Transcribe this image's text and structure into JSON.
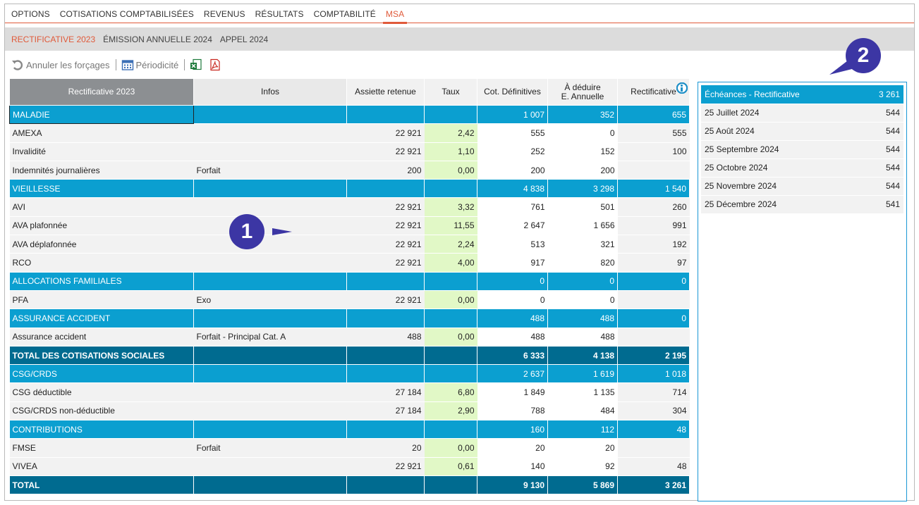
{
  "topnav": {
    "items": [
      "OPTIONS",
      "COTISATIONS COMPTABILISÉES",
      "REVENUS",
      "RÉSULTATS",
      "COMPTABILITÉ",
      "MSA"
    ],
    "active_index": 5
  },
  "subnav": {
    "items": [
      "RECTIFICATIVE 2023",
      "ÉMISSION ANNUELLE 2024",
      "APPEL 2024"
    ],
    "active_index": 0
  },
  "toolbar": {
    "cancel_label": "Annuler les forçages",
    "periodicity_label": "Périodicité"
  },
  "table": {
    "headers": {
      "first": "Rectificative 2023",
      "infos": "Infos",
      "assiette": "Assiette retenue",
      "taux": "Taux",
      "cot": "Cot. Définitives",
      "deduire_line1": "À déduire",
      "deduire_line2": "E. Annuelle",
      "rect": "Rectificative"
    },
    "rows": [
      {
        "type": "section",
        "label": "MALADIE",
        "infos": "",
        "assiette": "",
        "taux": "",
        "cot": "1 007",
        "ded": "352",
        "rect": "655"
      },
      {
        "type": "item",
        "label": "AMEXA",
        "info": true,
        "infos": "",
        "assiette": "22 921",
        "taux": "2,42",
        "cot": "555",
        "ded": "0",
        "rect": "555"
      },
      {
        "type": "item",
        "label": "Invalidité",
        "info": true,
        "infos": "",
        "assiette": "22 921",
        "taux": "1,10",
        "cot": "252",
        "ded": "152",
        "rect": "100"
      },
      {
        "type": "item",
        "label": "Indemnités journalières",
        "info": false,
        "infos": "Forfait",
        "assiette": "200",
        "taux": "0,00",
        "cot": "200",
        "ded": "200",
        "rect": ""
      },
      {
        "type": "section",
        "label": "VIEILLESSE",
        "infos": "",
        "assiette": "",
        "taux": "",
        "cot": "4 838",
        "ded": "3 298",
        "rect": "1 540"
      },
      {
        "type": "item",
        "label": "AVI",
        "info": true,
        "infos": "",
        "assiette": "22 921",
        "taux": "3,32",
        "cot": "761",
        "ded": "501",
        "rect": "260"
      },
      {
        "type": "item",
        "label": "AVA plafonnée",
        "info": true,
        "infos": "",
        "assiette": "22 921",
        "taux": "11,55",
        "cot": "2 647",
        "ded": "1 656",
        "rect": "991"
      },
      {
        "type": "item",
        "label": "AVA déplafonnée",
        "info": true,
        "infos": "",
        "assiette": "22 921",
        "taux": "2,24",
        "cot": "513",
        "ded": "321",
        "rect": "192"
      },
      {
        "type": "item",
        "label": "RCO",
        "info": true,
        "infos": "",
        "assiette": "22 921",
        "taux": "4,00",
        "cot": "917",
        "ded": "820",
        "rect": "97"
      },
      {
        "type": "section",
        "label": "ALLOCATIONS FAMILIALES",
        "infos": "",
        "assiette": "",
        "taux": "",
        "cot": "0",
        "ded": "0",
        "rect": "0"
      },
      {
        "type": "item",
        "label": "PFA",
        "info": true,
        "infos": "Exo",
        "assiette": "22 921",
        "taux": "0,00",
        "cot": "0",
        "ded": "0",
        "rect": ""
      },
      {
        "type": "section",
        "label": "ASSURANCE ACCIDENT",
        "infos": "",
        "assiette": "",
        "taux": "",
        "cot": "488",
        "ded": "488",
        "rect": "0"
      },
      {
        "type": "item",
        "label": "Assurance accident",
        "info": true,
        "infos": "Forfait - Principal Cat. A",
        "assiette": "488",
        "taux": "0,00",
        "cot": "488",
        "ded": "488",
        "rect": ""
      },
      {
        "type": "total",
        "label": "TOTAL DES COTISATIONS SOCIALES",
        "infos": "",
        "assiette": "",
        "taux": "",
        "cot": "6 333",
        "ded": "4 138",
        "rect": "2 195"
      },
      {
        "type": "section",
        "label": "CSG/CRDS",
        "infos": "",
        "assiette": "",
        "taux": "",
        "cot": "2 637",
        "ded": "1 619",
        "rect": "1 018"
      },
      {
        "type": "item",
        "label": "CSG déductible",
        "info": true,
        "infos": "",
        "assiette": "27 184",
        "taux": "6,80",
        "cot": "1 849",
        "ded": "1 135",
        "rect": "714"
      },
      {
        "type": "item",
        "label": "CSG/CRDS non-déductible",
        "info": true,
        "infos": "",
        "assiette": "27 184",
        "taux": "2,90",
        "cot": "788",
        "ded": "484",
        "rect": "304"
      },
      {
        "type": "section",
        "label": "CONTRIBUTIONS",
        "infos": "",
        "assiette": "",
        "taux": "",
        "cot": "160",
        "ded": "112",
        "rect": "48"
      },
      {
        "type": "item",
        "label": "FMSE",
        "info": true,
        "infos": "Forfait",
        "assiette": "20",
        "taux": "0,00",
        "cot": "20",
        "ded": "20",
        "rect": ""
      },
      {
        "type": "item",
        "label": "VIVEA",
        "info": true,
        "infos": "",
        "assiette": "22 921",
        "taux": "0,61",
        "cot": "140",
        "ded": "92",
        "rect": "48"
      },
      {
        "type": "total",
        "label": "TOTAL",
        "infos": "",
        "assiette": "",
        "taux": "",
        "cot": "9 130",
        "ded": "5 869",
        "rect": "3 261"
      }
    ]
  },
  "echeances": {
    "title": "Échéances - Rectificative",
    "total": "3 261",
    "rows": [
      {
        "date": "25 Juillet 2024",
        "amount": "544"
      },
      {
        "date": "25 Août 2024",
        "amount": "544"
      },
      {
        "date": "25 Septembre 2024",
        "amount": "544"
      },
      {
        "date": "25 Octobre 2024",
        "amount": "544"
      },
      {
        "date": "25 Novembre 2024",
        "amount": "544"
      },
      {
        "date": "25 Décembre 2024",
        "amount": "541"
      }
    ]
  },
  "callouts": {
    "one": "1",
    "two": "2"
  },
  "colors": {
    "accent": "#e05a3a",
    "section": "#0b9fd0",
    "total": "#006b90",
    "taux_bg": "#e1f8c6",
    "badge": "#3c36a4"
  }
}
